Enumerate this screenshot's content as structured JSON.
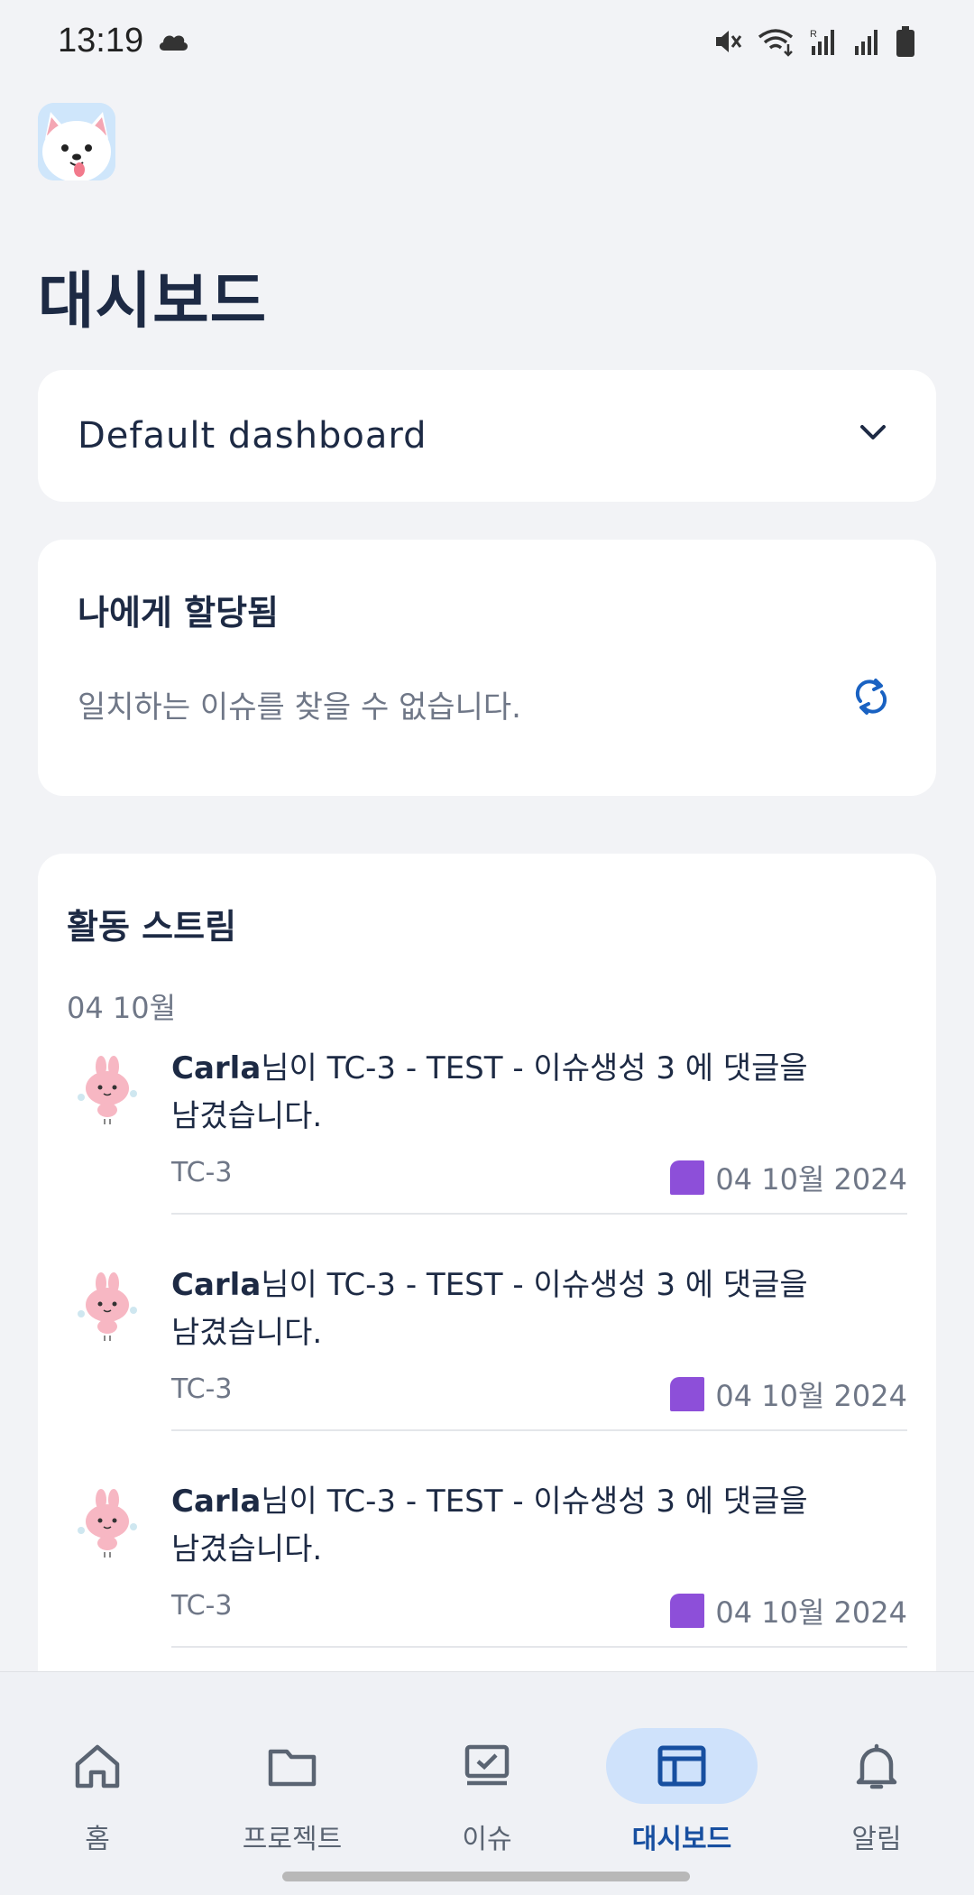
{
  "status_bar": {
    "time": "13:19",
    "icons": [
      "cloud-icon",
      "mute-icon",
      "wifi-icon",
      "signal-icon",
      "signal-icon",
      "battery-icon"
    ]
  },
  "page": {
    "title": "대시보드"
  },
  "dashboard_select": {
    "selected": "Default dashboard"
  },
  "assigned": {
    "title": "나에게 할당됨",
    "empty_text": "일치하는 이슈를 찾을 수 없습니다."
  },
  "activity": {
    "title": "활동 스트림",
    "date_group": "04 10월",
    "items": [
      {
        "user": "Carla",
        "text_line1": "님이 TC-3 - TEST - 이슈생성 3 에 댓글을",
        "text_line2": "남겼습니다.",
        "key": "TC-3",
        "date": "04 10월 2024"
      },
      {
        "user": "Carla",
        "text_line1": "님이 TC-3 - TEST - 이슈생성 3 에 댓글을",
        "text_line2": "남겼습니다.",
        "key": "TC-3",
        "date": "04 10월 2024"
      },
      {
        "user": "Carla",
        "text_line1": "님이 TC-3 - TEST - 이슈생성 3 에 댓글을",
        "text_line2": "남겼습니다.",
        "key": "TC-3",
        "date": "04 10월 2024"
      }
    ]
  },
  "nav": {
    "items": [
      {
        "label": "홈",
        "icon": "home-icon"
      },
      {
        "label": "프로젝트",
        "icon": "folder-icon"
      },
      {
        "label": "이슈",
        "icon": "issue-icon"
      },
      {
        "label": "대시보드",
        "icon": "dashboard-icon",
        "active": true
      },
      {
        "label": "알림",
        "icon": "bell-icon"
      }
    ]
  },
  "colors": {
    "accent": "#174fa0",
    "active_nav_bg": "#cfe2fb",
    "project_color": "#8d4fd9"
  }
}
